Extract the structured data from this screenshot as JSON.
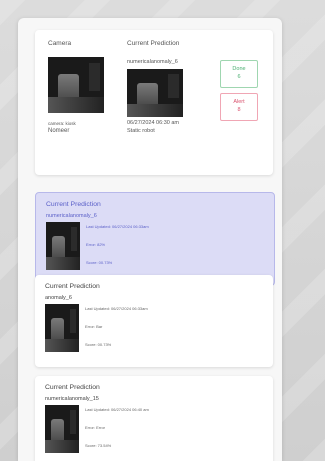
{
  "top": {
    "camera_heading": "Camera",
    "prediction_heading": "Current Prediction",
    "camera_name_label": "camera: kiosk",
    "camera_value": "Nomeer",
    "prediction_id": "numericalanomaly_6",
    "prediction_timestamp": "06/27/2024 06:30 am",
    "prediction_status": "Static robot",
    "stats": [
      {
        "title": "Done",
        "value": "6",
        "color": "#4caf72"
      },
      {
        "title": "Alert",
        "value": "8",
        "color": "#d9536f"
      }
    ]
  },
  "predictions": [
    {
      "title": "Current Prediction",
      "id": "numericalanomaly_6",
      "updated": "Last Updated: 06/27/2024 06:33am",
      "line2": "Error: 82%",
      "line3": "Score: 00.73%",
      "active": true
    },
    {
      "title": "Current Prediction",
      "id": "anomaly_6",
      "updated": "Last Updated: 06/27/2024 06:33am",
      "line2": "Error: Bar",
      "line3": "Score: 00.73%",
      "active": false
    },
    {
      "title": "Current Prediction",
      "id": "numericalanomaly_15",
      "updated": "Last Updated: 06/27/2024 06:40 am",
      "line2": "Error: Error",
      "line3": "Score: 73.54%",
      "active": false
    }
  ]
}
